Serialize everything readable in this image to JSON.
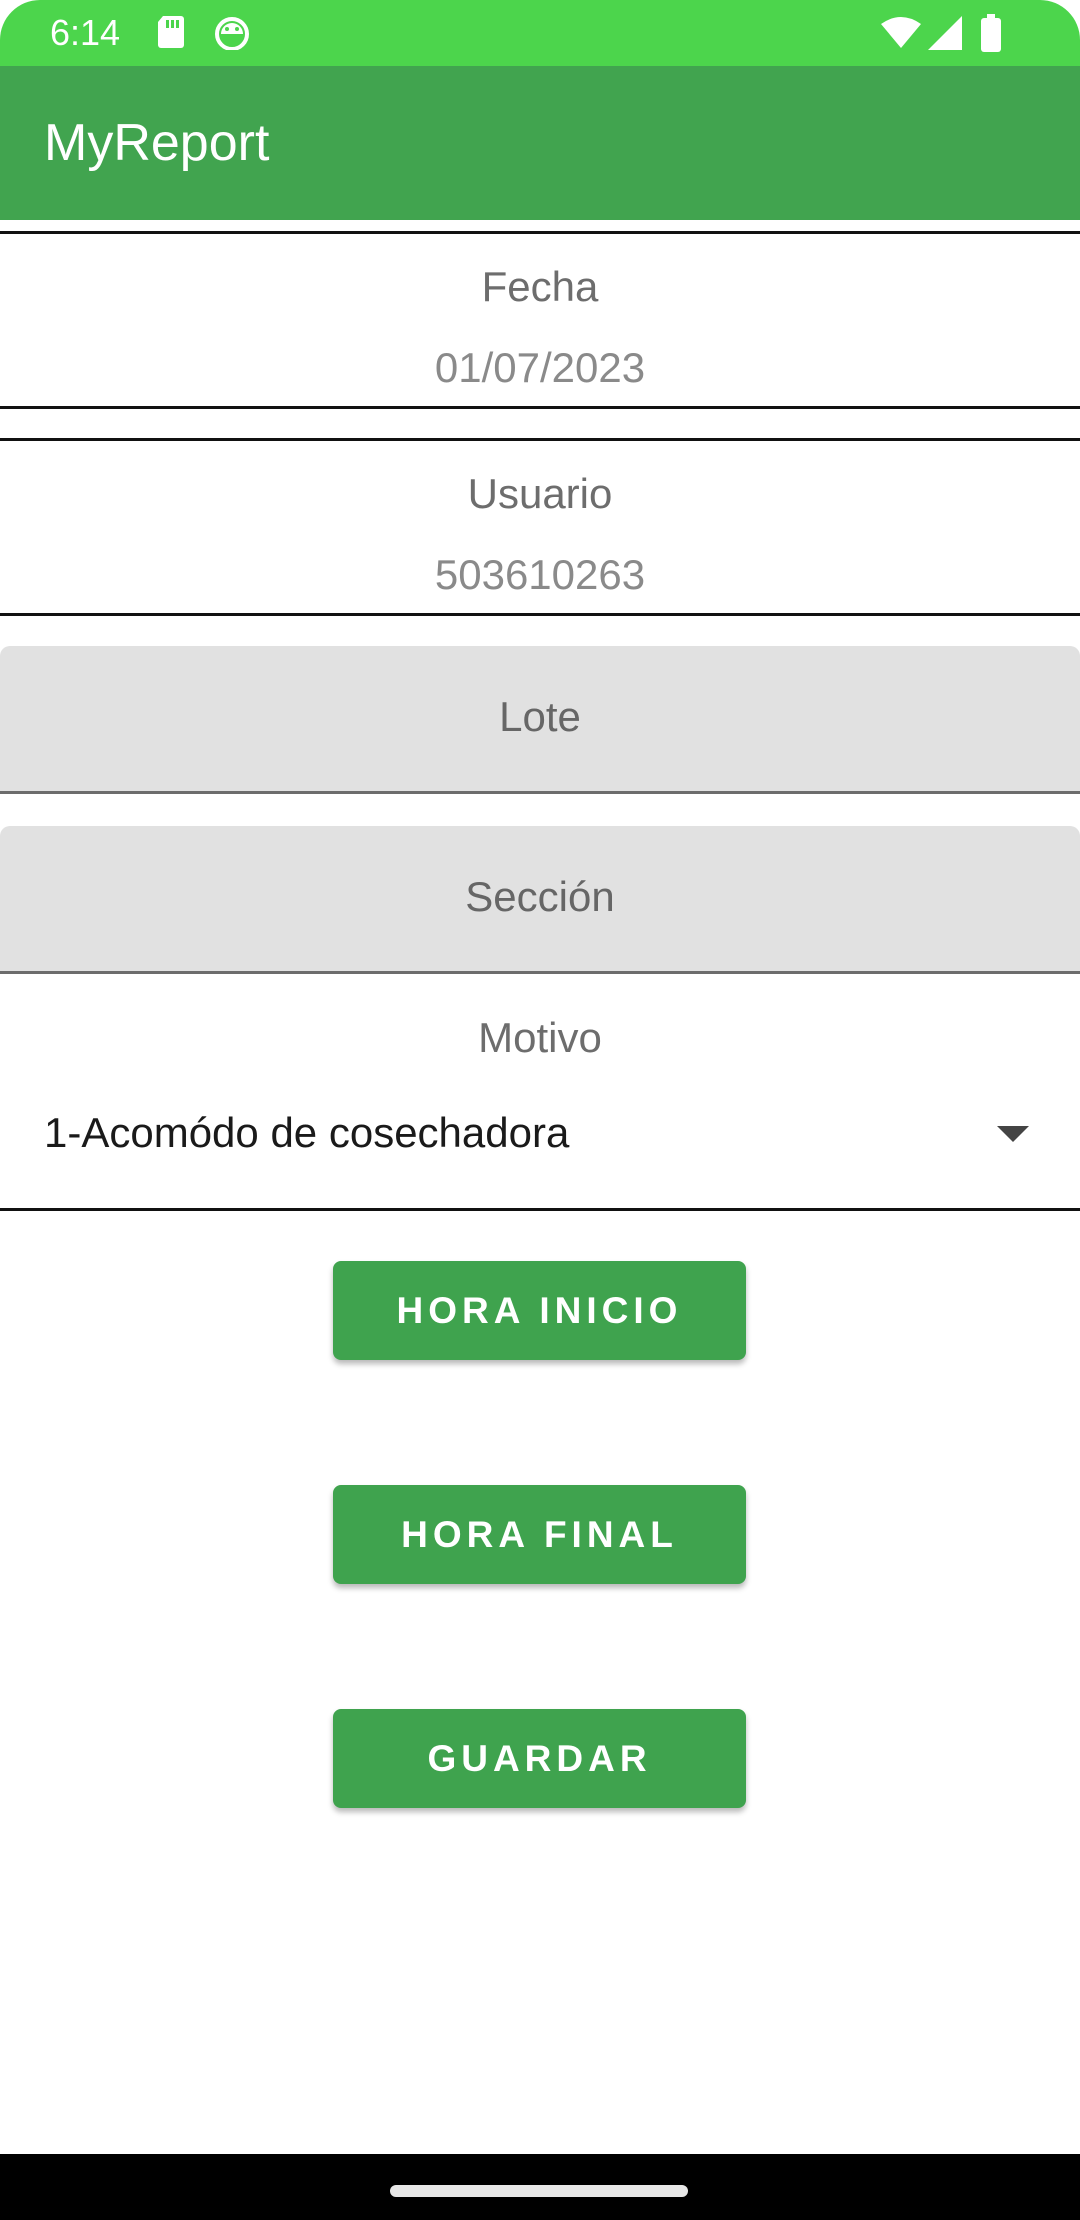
{
  "status_bar": {
    "time": "6:14",
    "left_icons": [
      "sd-card-icon",
      "android-debug-icon"
    ],
    "right_icons": [
      "wifi-icon",
      "signal-icon",
      "battery-icon"
    ]
  },
  "app_bar": {
    "title": "MyReport",
    "color": "#41a44f"
  },
  "form": {
    "fecha": {
      "label": "Fecha",
      "value": "01/07/2023"
    },
    "usuario": {
      "label": "Usuario",
      "value": "503610263"
    },
    "lote": {
      "placeholder": "Lote",
      "value": ""
    },
    "seccion": {
      "placeholder": "Sección",
      "value": ""
    },
    "motivo": {
      "label": "Motivo",
      "selected": "1-Acomódo de cosechadora"
    }
  },
  "buttons": {
    "hora_inicio": "HORA INICIO",
    "hora_final": "HORA FINAL",
    "guardar": "GUARDAR",
    "color": "#3fa34e"
  }
}
